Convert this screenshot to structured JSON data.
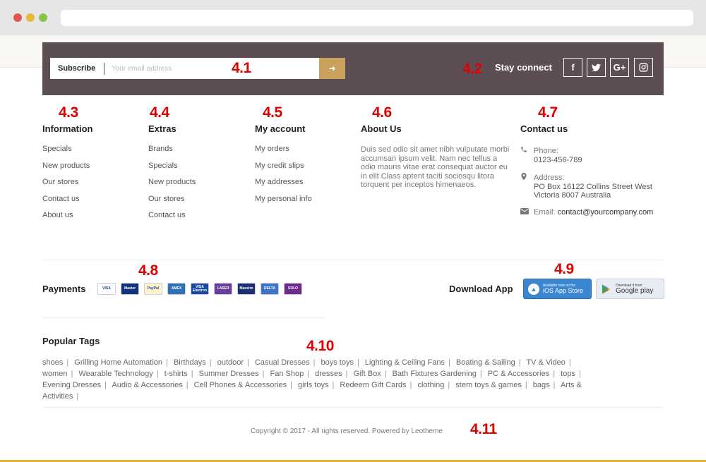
{
  "newsletter": {
    "subscribe_label": "Subscribe",
    "email_placeholder": "Your email address",
    "submit_icon": "arrow-right-icon",
    "stay_connect_label": "Stay connect",
    "social": [
      {
        "glyph": "f",
        "icon": "facebook-icon"
      },
      {
        "glyph": "🐦",
        "icon": "twitter-icon"
      },
      {
        "glyph": "G+",
        "icon": "google-plus-icon"
      },
      {
        "glyph": "◎",
        "icon": "instagram-icon"
      }
    ]
  },
  "annotations": {
    "m41": "4.1",
    "m42": "4.2",
    "m43": "4.3",
    "m44": "4.4",
    "m45": "4.5",
    "m46": "4.6",
    "m47": "4.7",
    "m48": "4.8",
    "m49": "4.9",
    "m410": "4.10",
    "m411": "4.11"
  },
  "information": {
    "title": "Information",
    "items": [
      "Specials",
      "New products",
      "Our stores",
      "Contact us",
      "About us"
    ]
  },
  "extras": {
    "title": "Extras",
    "items": [
      "Brands",
      "Specials",
      "New products",
      "Our stores",
      "Contact us"
    ]
  },
  "my_account": {
    "title": "My account",
    "items": [
      "My orders",
      "My credit slips",
      "My addresses",
      "My personal info"
    ]
  },
  "about_us": {
    "title": "About Us",
    "text": "Duis sed odio sit amet nibh vulputate morbi accumsan ipsum velit. Nam nec tellus a odio mauris vitae erat consequat auctor eu in elit Class aptent taciti sociosqu litora torquent per inceptos himenaeos."
  },
  "contact_us": {
    "title": "Contact us",
    "phone_label": "Phone:",
    "phone": "0123-456-789",
    "address_label": "Address:",
    "address_line1": "PO Box 16122 Collins Street West",
    "address_line2": "Victoria 8007 Australia",
    "email_label": "Email:",
    "email": "contact@yourcompany.com"
  },
  "payments": {
    "title": "Payments",
    "cards": [
      {
        "label": "VISA",
        "bg": "#ffffff",
        "fg": "#1a3d8f"
      },
      {
        "label": "Master",
        "bg": "#10337a",
        "fg": "#ffffff"
      },
      {
        "label": "PayPal",
        "bg": "#fff4cc",
        "fg": "#1b4a9c"
      },
      {
        "label": "AMEX",
        "bg": "#2f6fb5",
        "fg": "#ffffff"
      },
      {
        "label": "VISA Electron",
        "bg": "#1a4a9e",
        "fg": "#ffffff"
      },
      {
        "label": "LASER",
        "bg": "#6a3d9a",
        "fg": "#ffffff"
      },
      {
        "label": "Maestro",
        "bg": "#1a3072",
        "fg": "#ffffff"
      },
      {
        "label": "DELTA",
        "bg": "#3b74c9",
        "fg": "#ffffff"
      },
      {
        "label": "SOLO",
        "bg": "#6c2a8c",
        "fg": "#ffffff"
      }
    ]
  },
  "download": {
    "title": "Download App",
    "app_store_top": "Available now on the",
    "app_store": "iOS App Store",
    "google_play_top": "Download it from",
    "google_play": "Google play"
  },
  "popular_tags": {
    "title": "Popular Tags",
    "tags": [
      "shoes",
      "Grilling Home Automation",
      "Birthdays",
      "outdoor",
      "Casual Dresses",
      "boys toys",
      "Lighting & Ceiling Fans",
      "Boating & Sailing",
      "TV & Video",
      "women",
      "Wearable Technology",
      "t-shirts",
      "Summer Dresses",
      "Fan Shop",
      "dresses",
      "Gift Box",
      "Bath Fixtures Gardening",
      "PC & Accessories",
      "tops",
      "Evening Dresses",
      "Audio & Accessories",
      "Cell Phones & Accessories",
      "girls toys",
      "Redeem Gift Cards",
      "clothing",
      "stem toys & games",
      "bags",
      "Arts & Activities"
    ]
  },
  "copyright": "Copyright © 2017 - All rights reserved. Powered by Leotheme",
  "colors": {
    "newsletter_bg": "#5d4e55",
    "accent": "#c9a15c",
    "marker": "#e00000",
    "bottom_bar": "#e4b33b"
  }
}
